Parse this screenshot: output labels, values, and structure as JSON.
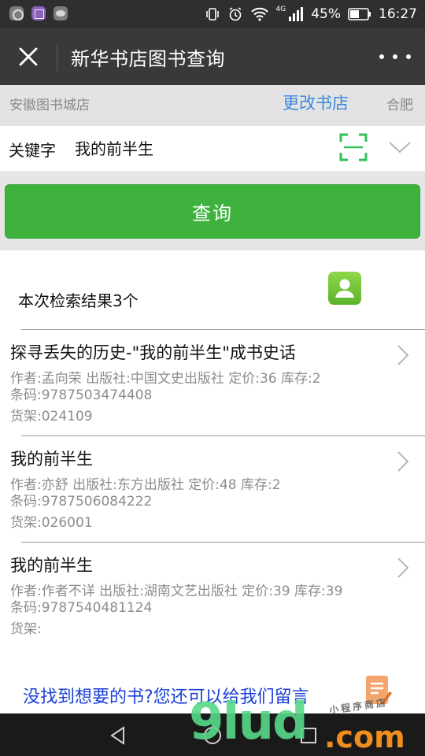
{
  "status_bar": {
    "network": "4G",
    "battery": "45%",
    "time": "16:27"
  },
  "header": {
    "title": "新华书店图书查询"
  },
  "store": {
    "name": "安徽图书城店",
    "change_label": "更改书店",
    "city": "合肥"
  },
  "search": {
    "keyword_label": "关键字",
    "keyword_value": "我的前半生",
    "query_button": "查询"
  },
  "results": {
    "count_text": "本次检索结果3个",
    "items": [
      {
        "title": "探寻丢失的历史-\"我的前半生\"成书史话",
        "meta": "作者:孟向荣 出版社:中国文史出版社 定价:36 库存:2",
        "barcode": "条码:9787503474408",
        "shelf": "货架:024109"
      },
      {
        "title": "我的前半生",
        "meta": "作者:亦舒 出版社:东方出版社 定价:48 库存:2",
        "barcode": "条码:9787506084222",
        "shelf": "货架:026001"
      },
      {
        "title": "我的前半生",
        "meta": "作者:作者不详 出版社:湖南文艺出版社 定价:39 库存:39",
        "barcode": "条码:9787540481124",
        "shelf": "货架:"
      }
    ]
  },
  "feedback": {
    "text": "没找到想要的书?您还可以给我们留言"
  },
  "watermark": {
    "main": "9lud",
    "suffix": ".com",
    "small": "小程序商店"
  },
  "colors": {
    "accent_green": "#3eb23d",
    "link_blue": "#3b8ae0",
    "feedback_blue": "#1a3fd8",
    "title_bar": "#39393c"
  }
}
